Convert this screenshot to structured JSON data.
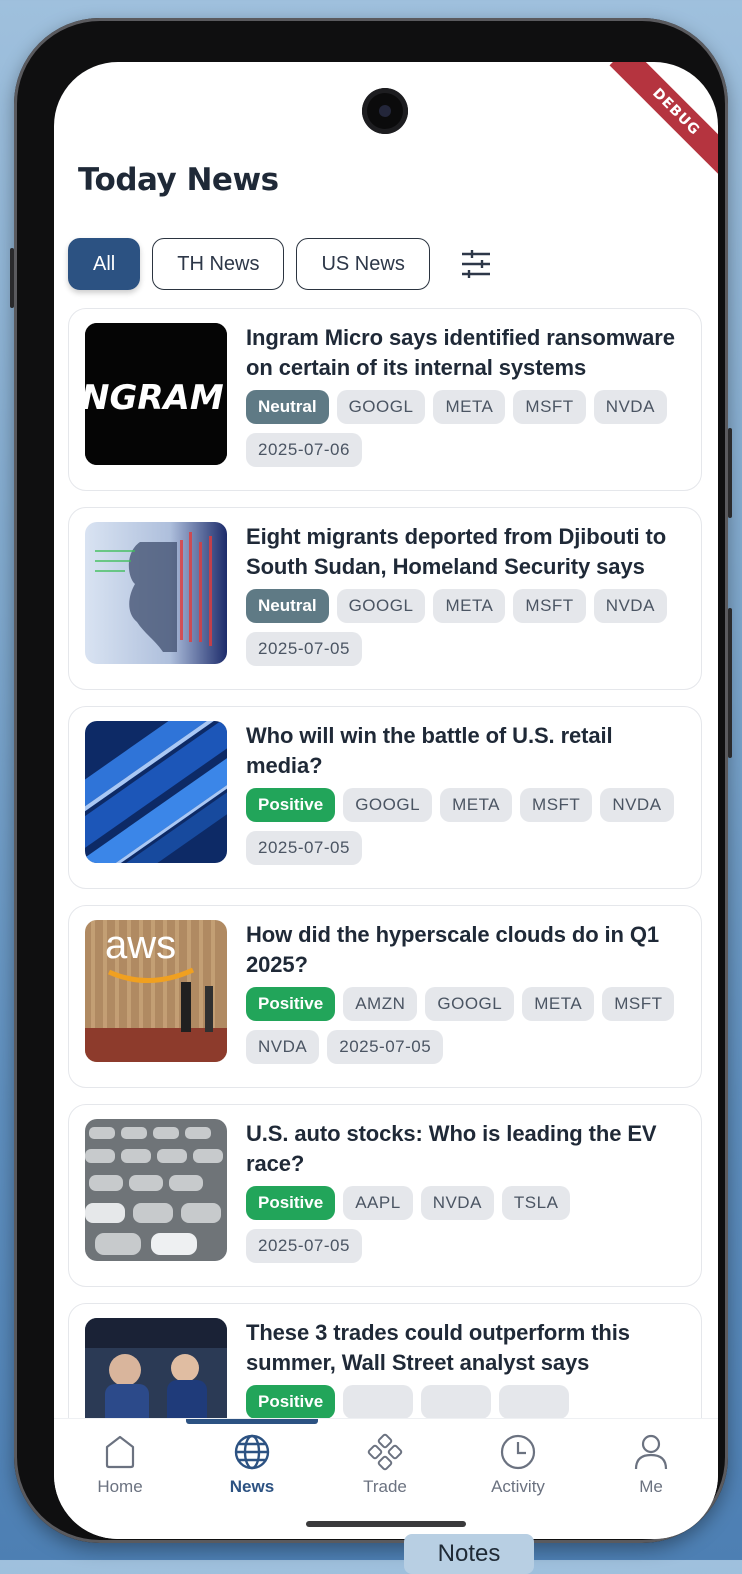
{
  "app": {
    "debug_banner": "DEBUG",
    "page_title": "Today News"
  },
  "filters": {
    "tabs": [
      {
        "label": "All",
        "active": true
      },
      {
        "label": "TH News",
        "active": false
      },
      {
        "label": "US News",
        "active": false
      }
    ],
    "filter_icon": "sliders-icon"
  },
  "news": [
    {
      "title": "Ingram Micro says identified ransomware on certain of its internal systems",
      "thumbnail": "ingram-logo",
      "sentiment": "Neutral",
      "tickers": [
        "GOOGL",
        "META",
        "MSFT",
        "NVDA"
      ],
      "date": "2025-07-06"
    },
    {
      "title": "Eight migrants deported from Djibouti to South Sudan, Homeland Security says",
      "thumbnail": "stock-screen-silhouette",
      "sentiment": "Neutral",
      "tickers": [
        "GOOGL",
        "META",
        "MSFT",
        "NVDA"
      ],
      "date": "2025-07-05"
    },
    {
      "title": "Who will win the battle of U.S. retail media?",
      "thumbnail": "blue-retail-cards",
      "sentiment": "Positive",
      "tickers": [
        "GOOGL",
        "META",
        "MSFT",
        "NVDA"
      ],
      "date": "2025-07-05"
    },
    {
      "title": "How did the hyperscale clouds do in Q1 2025?",
      "thumbnail": "aws-sign",
      "sentiment": "Positive",
      "tickers": [
        "AMZN",
        "GOOGL",
        "META",
        "MSFT",
        "NVDA"
      ],
      "date": "2025-07-05"
    },
    {
      "title": "U.S. auto stocks: Who is leading the EV race?",
      "thumbnail": "parked-cars",
      "sentiment": "Positive",
      "tickers": [
        "AAPL",
        "NVDA",
        "TSLA"
      ],
      "date": "2025-07-05"
    },
    {
      "title": "These 3 trades could outperform this summer, Wall Street analyst says",
      "thumbnail": "traders-floor",
      "sentiment": "Positive",
      "tickers": [
        "",
        "",
        ""
      ],
      "date": ""
    }
  ],
  "nav": {
    "items": [
      {
        "label": "Home",
        "icon": "home-icon",
        "active": false
      },
      {
        "label": "News",
        "icon": "globe-icon",
        "active": true
      },
      {
        "label": "Trade",
        "icon": "trade-icon",
        "active": false
      },
      {
        "label": "Activity",
        "icon": "clock-icon",
        "active": false
      },
      {
        "label": "Me",
        "icon": "person-icon",
        "active": false
      }
    ]
  },
  "desktop": {
    "notes_tab": "Notes"
  },
  "colors": {
    "accent": "#2c5282",
    "neutral": "#5f7a85",
    "positive": "#22a55a",
    "tag_bg": "#e5e7eb"
  }
}
